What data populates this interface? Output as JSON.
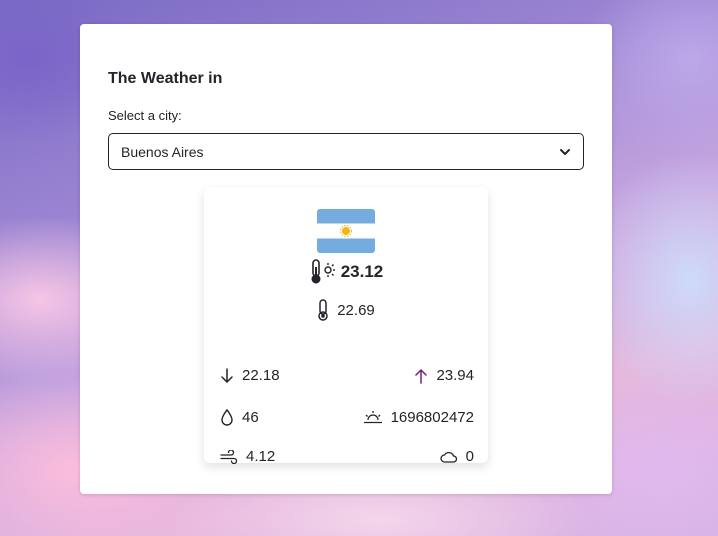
{
  "header": {
    "title": "The Weather in"
  },
  "city_select": {
    "label": "Select a city:",
    "selected": "Buenos Aires"
  },
  "weather": {
    "country_flag": "argentina-flag",
    "temperature": "23.12",
    "feels_like": "22.69",
    "temp_min": "22.18",
    "temp_max": "23.94",
    "humidity": "46",
    "sunrise": "1696802472",
    "wind_speed": "4.12",
    "clouds": "0"
  },
  "colors": {
    "text": "#212529",
    "flag_blue": "#74ACDF",
    "flag_sun": "#F6B40E",
    "up_arrow": "#7a1f7a"
  }
}
